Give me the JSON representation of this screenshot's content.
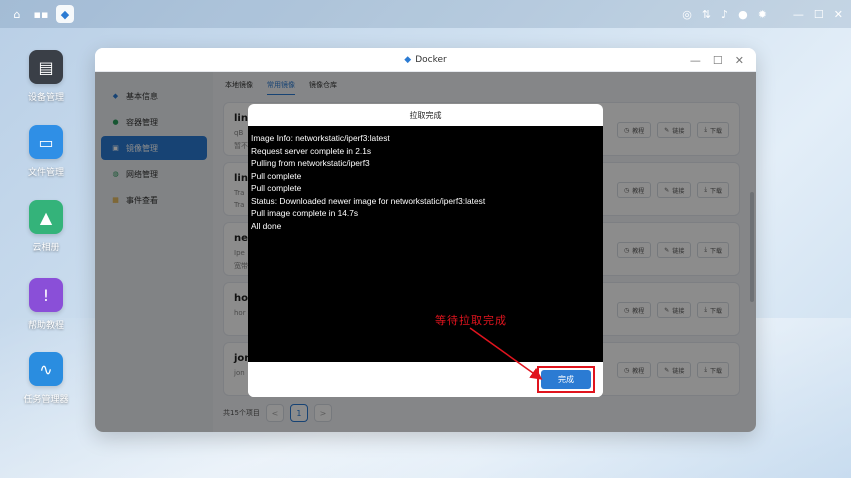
{
  "desktop": {
    "icons": [
      {
        "label": "设备管理",
        "icon": "device-icon"
      },
      {
        "label": "文件管理",
        "icon": "folder-icon"
      },
      {
        "label": "云相册",
        "icon": "photo-icon"
      },
      {
        "label": "帮助教程",
        "icon": "help-icon"
      },
      {
        "label": "任务管理器",
        "icon": "task-monitor-icon"
      }
    ]
  },
  "window": {
    "title": "Docker",
    "sidebar": {
      "items": [
        {
          "label": "基本信息"
        },
        {
          "label": "容器管理"
        },
        {
          "label": "镜像管理"
        },
        {
          "label": "网络管理"
        },
        {
          "label": "事件查看"
        }
      ]
    },
    "tabs": [
      {
        "label": "本地镜像"
      },
      {
        "label": "常用镜像"
      },
      {
        "label": "镜像仓库"
      }
    ],
    "cards": [
      {
        "name": "lin",
        "desc": "qB",
        "desc2": "暂不"
      },
      {
        "name": "lin",
        "desc": "Tra",
        "desc2": "Tra"
      },
      {
        "name": "net",
        "desc": "Ipe",
        "desc2": "宽带"
      },
      {
        "name": "hor",
        "desc": "hor",
        "desc2": ""
      },
      {
        "name": "jon",
        "desc": "jon",
        "desc2": ""
      }
    ],
    "card_buttons": {
      "tutorial": "教程",
      "link": "链接",
      "download": "下载"
    },
    "pager": {
      "total": "共15个项目",
      "current": "1",
      "prev": "<",
      "next": ">"
    }
  },
  "modal": {
    "title": "拉取完成",
    "log_lines": [
      "Image Info: networkstatic/iperf3:latest",
      "Request server complete in 2.1s",
      "Pulling from networkstatic/iperf3",
      "Pull complete",
      "Pull complete",
      "Status: Downloaded newer image for networkstatic/iperf3:latest",
      "Pull image complete in 14.7s",
      "All done"
    ],
    "done_label": "完成"
  },
  "annotation": {
    "text": "等待拉取完成",
    "color": "#e0141e"
  },
  "colors": {
    "accent": "#2b7bd3"
  }
}
